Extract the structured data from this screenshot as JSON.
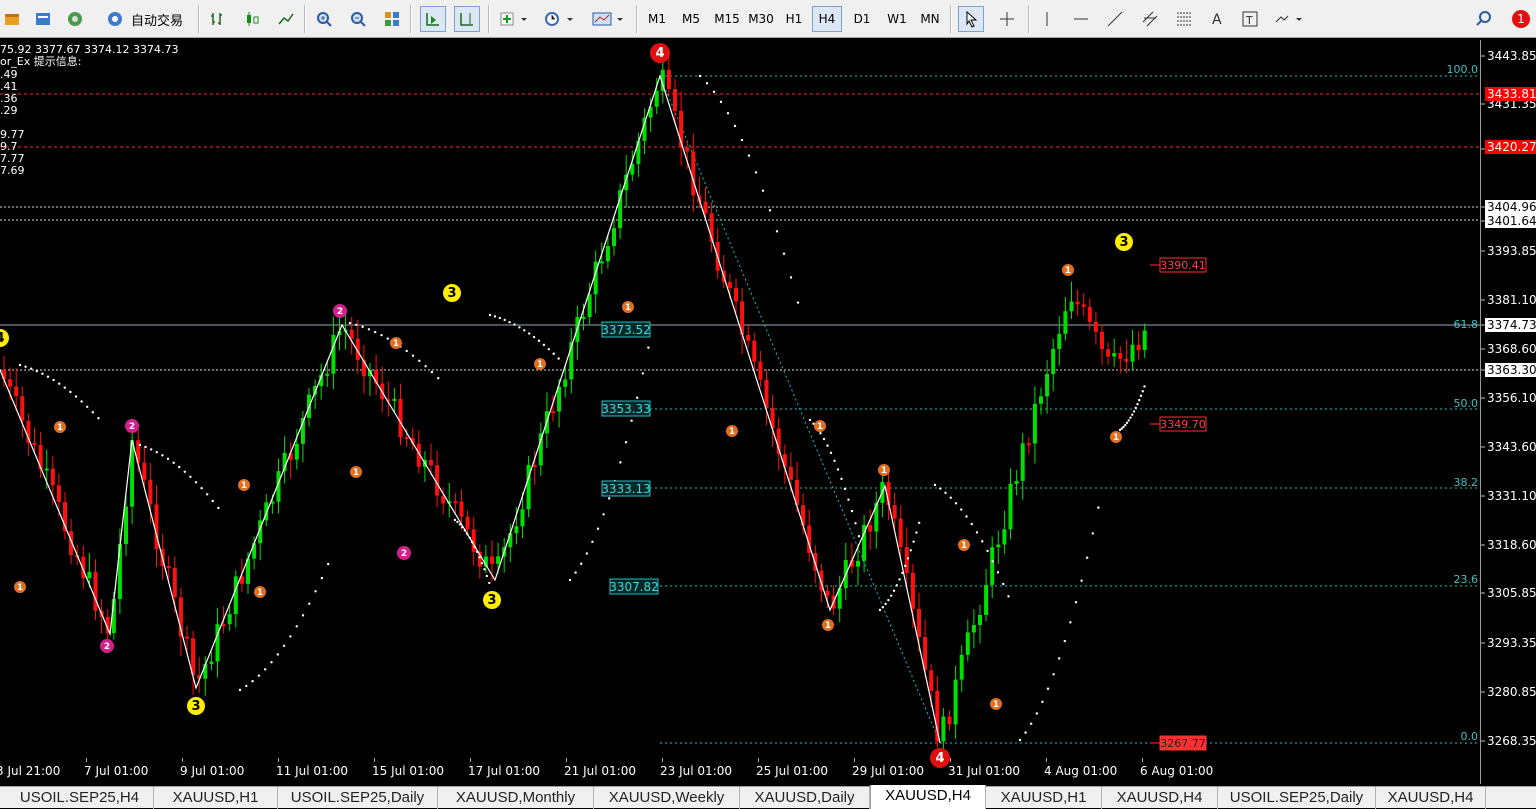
{
  "toolbar": {
    "auto_trade_label": "自动交易",
    "timeframes": [
      "M1",
      "M5",
      "M15",
      "M30",
      "H1",
      "H4",
      "D1",
      "W1",
      "MN"
    ],
    "active_timeframe": "H4",
    "alert_count": "1"
  },
  "info": {
    "ohlc": "75.92 3377.67 3374.12 3374.73",
    "indicator": "or_Ex 提示信息:",
    "values": [
      ".49",
      ".41",
      ".36",
      ".29",
      "9.77",
      "9.7",
      "7.77",
      "7.69"
    ]
  },
  "price_axis": {
    "labels": [
      "3443.85",
      "3431.35",
      "3418.85",
      "3404.96",
      "3401.64",
      "3393.85",
      "3381.10",
      "3374.73",
      "3368.60",
      "3363.30",
      "3356.10",
      "3343.60",
      "3331.10",
      "3318.60",
      "3305.85",
      "3293.35",
      "3280.85",
      "3268.35"
    ],
    "red_labels": [
      "3433.81",
      "3420.27"
    ],
    "current": "3374.73",
    "accent_red": "#ff0000"
  },
  "time_axis": [
    "3 Jul 21:00",
    "7 Jul 01:00",
    "9 Jul 01:00",
    "11 Jul 01:00",
    "15 Jul 01:00",
    "17 Jul 01:00",
    "21 Jul 01:00",
    "23 Jul 01:00",
    "25 Jul 01:00",
    "29 Jul 01:00",
    "31 Jul 01:00",
    "4 Aug 01:00",
    "6 Aug 01:00"
  ],
  "fib": {
    "levels": [
      "100.0",
      "61.8",
      "50.0",
      "38.2",
      "23.6",
      "0.0"
    ],
    "prices": [
      "3373.52",
      "3353.33",
      "3333.13",
      "3307.82"
    ],
    "box_color": "#20c0c0"
  },
  "price_tags": {
    "top": "3390.41",
    "mid": "3349.70",
    "bottom": "3267.77"
  },
  "wave_labels": [
    "1",
    "2",
    "3",
    "4"
  ],
  "tabs": [
    "USOIL.SEP25,H4",
    "XAUUSD,H1",
    "USOIL.SEP25,Daily",
    "XAUUSD,Monthly",
    "XAUUSD,Weekly",
    "XAUUSD,Daily",
    "XAUUSD,H4",
    "XAUUSD,H1",
    "XAUUSD,H4",
    "USOIL.SEP25,Daily",
    "XAUUSD,H4"
  ],
  "active_tab": "XAUUSD,H4",
  "colors": {
    "bull": "#00e000",
    "bear": "#ff1010",
    "wave": "#ffffff",
    "label_orange": "#e07020",
    "label_magenta": "#d0208a",
    "label_yellow": "#ffee00"
  }
}
